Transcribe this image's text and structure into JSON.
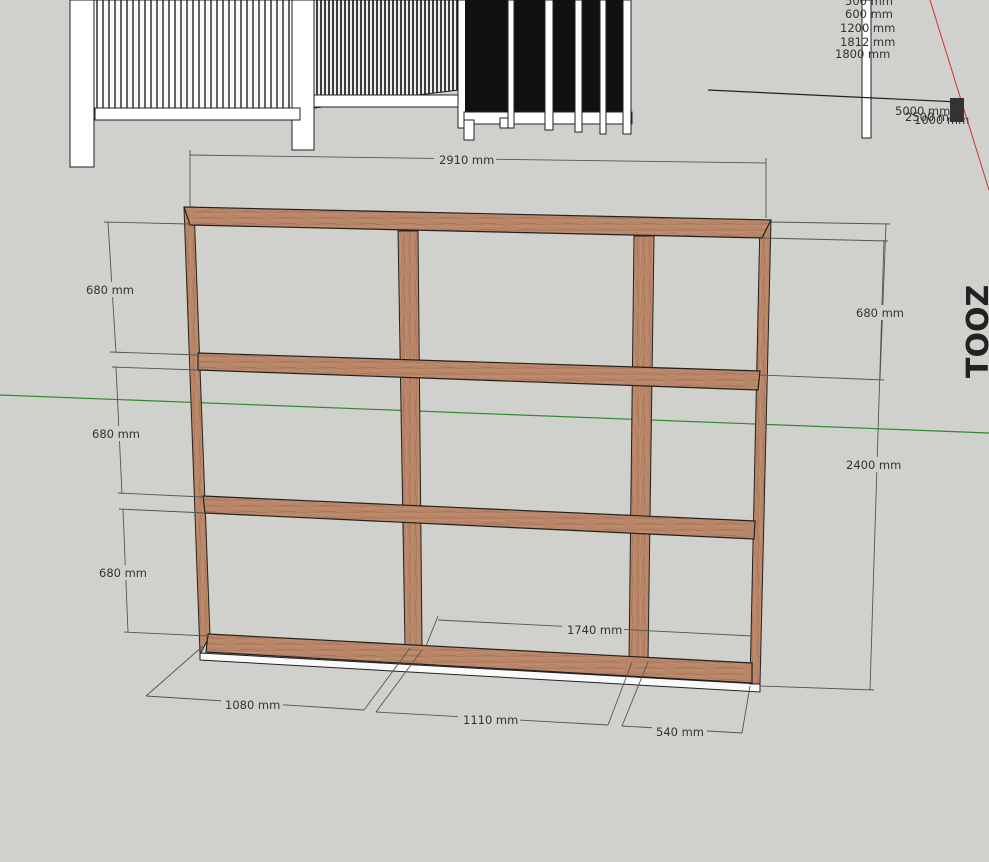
{
  "colors": {
    "background": "#d0d0cc",
    "wood": "#b98567",
    "wood_dark": "#8f5f45",
    "green_axis": "#2e8b2e",
    "red_axis": "#cc3333",
    "dimension_line": "#555555"
  },
  "dimensions": {
    "top_width": "2910 mm",
    "left_top": "680 mm",
    "left_mid": "680 mm",
    "left_bottom": "680 mm",
    "right_top": "680 mm",
    "right_height": "2400 mm",
    "inner_span": "1740 mm",
    "bottom_left": "1080 mm",
    "bottom_mid": "1110 mm",
    "bottom_right": "540 mm"
  },
  "background_labels": {
    "l1": "500 mm",
    "l2": "600 mm",
    "l3": "1200 mm",
    "l4": "1812 mm",
    "l5": "1800 mm",
    "l6": "5000 mm",
    "l7": "2500 mm",
    "l8": "1000 mm"
  },
  "background_objects": {
    "logo_text": "TOOZ"
  }
}
